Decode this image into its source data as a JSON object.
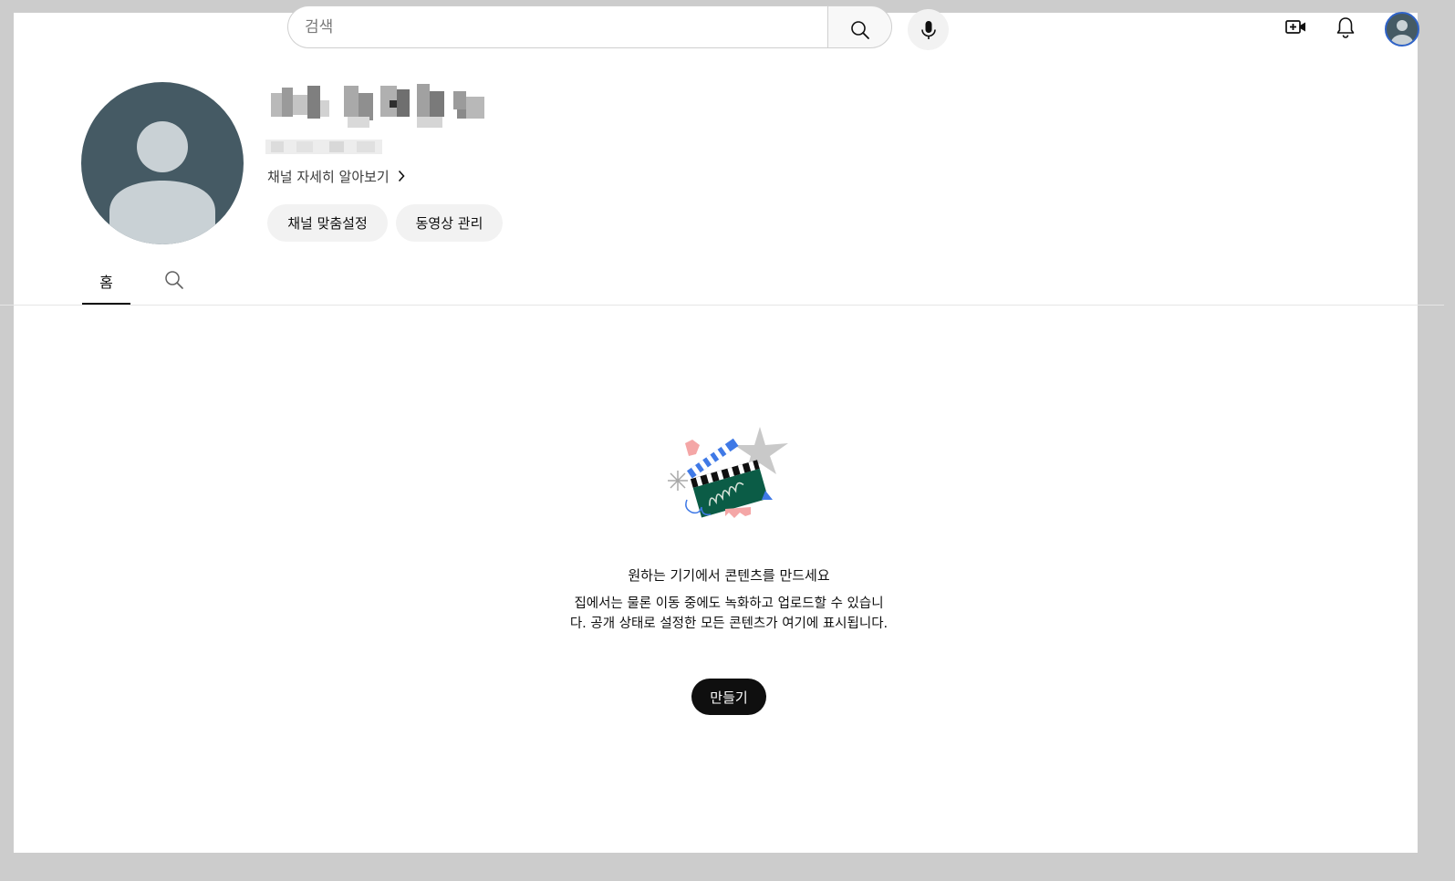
{
  "topbar": {
    "search": {
      "placeholder": "검색",
      "value": ""
    },
    "icons": {
      "search": "search-icon",
      "mic": "microphone-icon",
      "create": "video-create-icon",
      "notifications": "bell-icon",
      "account": "avatar"
    }
  },
  "channel": {
    "name_redacted": true,
    "handle_redacted": true,
    "more_link": "채널 자세히 알아보기",
    "buttons": {
      "customize": "채널 맞춤설정",
      "manage": "동영상 관리"
    }
  },
  "tabs": [
    {
      "label": "홈",
      "selected": true
    }
  ],
  "empty_state": {
    "title": "원하는 기기에서 콘텐츠를 만드세요",
    "description": "집에서는 물론 이동 중에도 녹화하고 업로드할 수 있습니다. 공개 상태로 설정한 모든 콘텐츠가 여기에 표시됩니다.",
    "cta": "만들기"
  },
  "colors": {
    "avatar_bg": "#455a64",
    "avatar_fg": "#c9d1d5",
    "pill_bg": "#f2f2f2",
    "cta_bg": "#0f0f0f",
    "clapper_green": "#0b5c46",
    "clapper_blue": "#3f79e6",
    "accent_pink": "#f4a6a6",
    "star_gray": "#c9c9c9"
  }
}
